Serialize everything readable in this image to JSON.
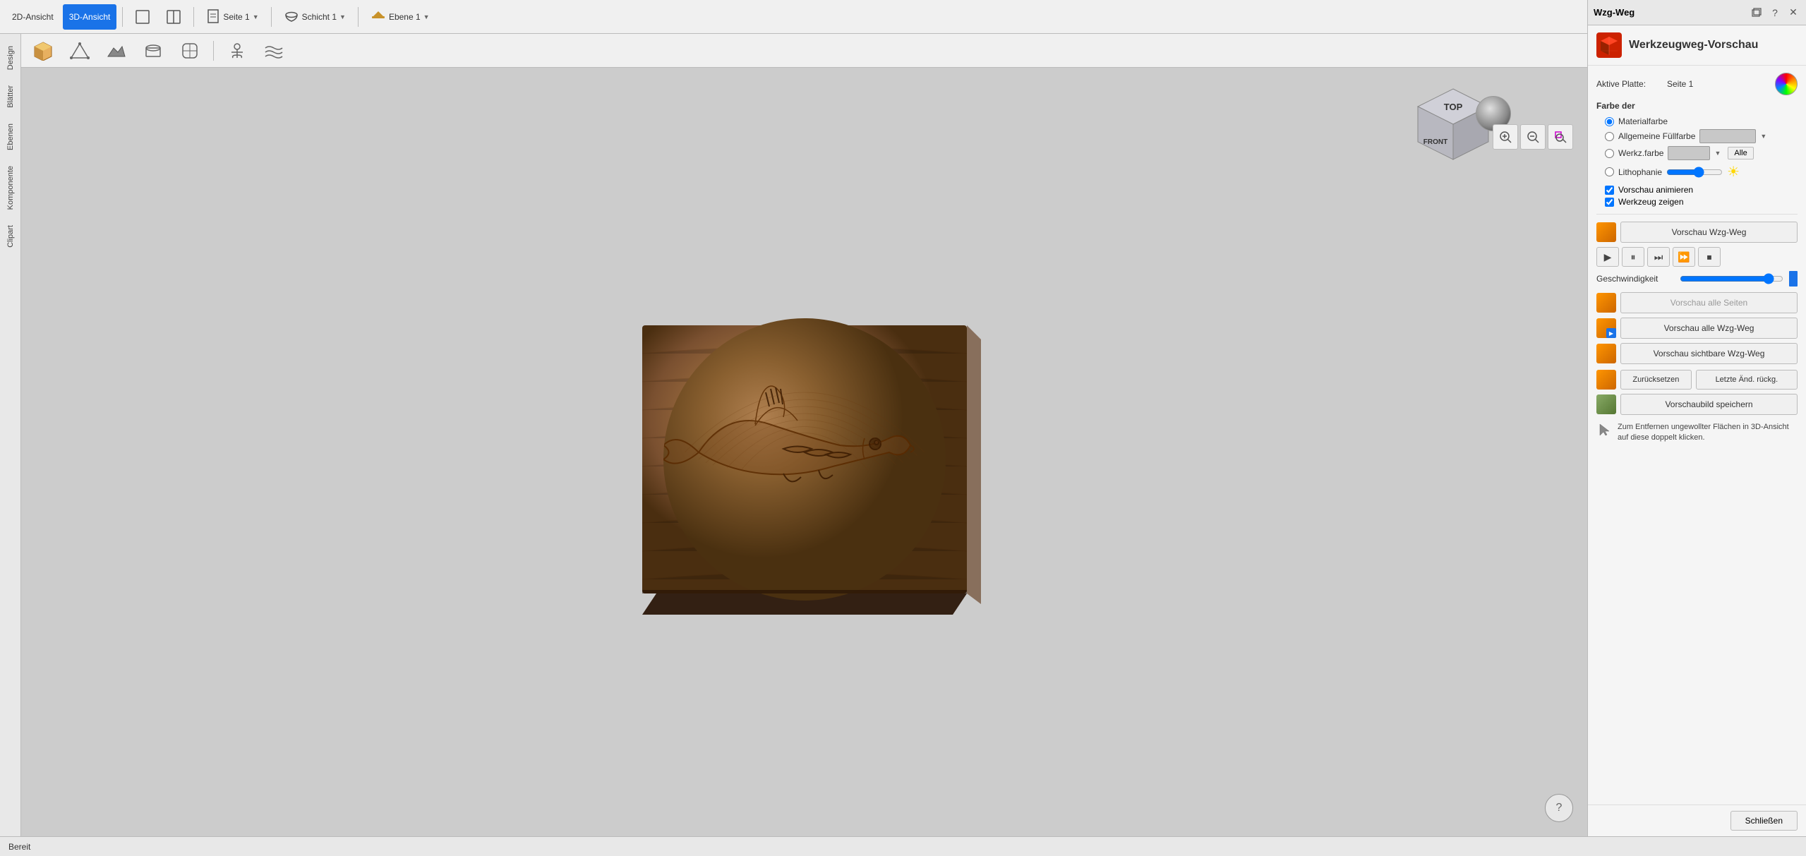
{
  "window": {
    "title": "Wzg-Weg"
  },
  "toolbar": {
    "view_2d": "2D-Ansicht",
    "view_3d": "3D-Ansicht",
    "page_label": "Seite 1",
    "layer_label": "Schicht 1",
    "level_label": "Ebene 1"
  },
  "sidebar": {
    "tabs": [
      "Design",
      "Blätter",
      "Ebenen",
      "Komponente",
      "Clipart"
    ]
  },
  "nav_cube": {
    "top_label": "TOP",
    "front_label": "FRONT"
  },
  "panel": {
    "title": "Wzg-Weg",
    "header_title": "Werkzeugweg-Vorschau",
    "active_plate_label": "Aktive Platte:",
    "active_plate_value": "Seite 1",
    "farbe_der_label": "Farbe der",
    "radio_materialfarbe": "Materialfarbe",
    "radio_allgemeine_fullfarbe": "Allgemeine Füllfarbe",
    "radio_werkzfarbe": "Werkz.farbe",
    "radio_lithophane": "Lithophanie",
    "alle_btn": "Alle",
    "checkbox_vorschau": "Vorschau animieren",
    "checkbox_werkzeug": "Werkzeug zeigen",
    "btn_vorschau_wzg": "Vorschau Wzg-Weg",
    "btn_vorschau_alle": "Vorschau alle Seiten",
    "btn_vorschau_alle_wzg": "Vorschau alle Wzg-Weg",
    "btn_vorschau_sichtbare": "Vorschau sichtbare Wzg-Weg",
    "btn_zuruecksetzen": "Zurücksetzen",
    "btn_letzte_aend": "Letzte Änd. rückg.",
    "btn_vorschaubild": "Vorschaubild speichern",
    "speed_label": "Geschwindigkeit",
    "info_text": "Zum Entfernen ungewollter Flächen in 3D-Ansicht auf diese doppelt klicken.",
    "btn_schliessen": "Schließen"
  },
  "status": {
    "text": "Bereit"
  },
  "playback": {
    "play": "▶",
    "pause": "⏸",
    "skip_end": "⏭",
    "fast_forward": "⏩",
    "stop": "⏹"
  }
}
